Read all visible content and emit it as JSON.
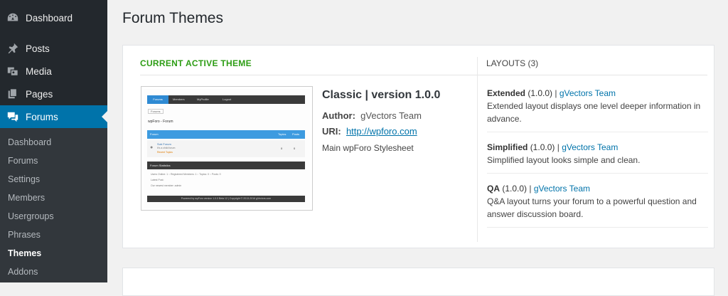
{
  "sidebar": {
    "top_items": [
      {
        "label": "Dashboard",
        "icon": "dashboard-icon"
      },
      {
        "label": "Posts",
        "icon": "pin-icon"
      },
      {
        "label": "Media",
        "icon": "media-icon"
      },
      {
        "label": "Pages",
        "icon": "pages-icon"
      },
      {
        "label": "Forums",
        "icon": "forums-icon"
      }
    ],
    "sub_items": [
      "Dashboard",
      "Forums",
      "Settings",
      "Members",
      "Usergroups",
      "Phrases",
      "Themes",
      "Addons"
    ]
  },
  "page_title": "Forum Themes",
  "current": {
    "section_title": "CURRENT ACTIVE THEME",
    "theme_name": "Classic | version 1.0.0",
    "author_label": "Author:",
    "author_value": "gVectors Team",
    "uri_label": "URI:",
    "uri_value": "http://wpforo.com",
    "description": "Main wpForo Stylesheet",
    "preview": {
      "nav": [
        "Forums",
        "Members",
        "MyProfile",
        "Logout"
      ],
      "crumb": "Forums",
      "title": "wpForo - Forum",
      "head_forum": "Forum",
      "head_topics": "Topics",
      "head_posts": "Posts",
      "sub_forum": "Sub Forum",
      "sub_forum_desc": "It's a child forum",
      "recent": "Recent Topics",
      "topics_count": "0",
      "posts_count": "0",
      "stats_head": "Forum Statistics",
      "stats_1": "Users Online: 1 :: Registered Members: 1 :: Topics: 0 :: Posts: 0",
      "stats_2": "Latest Post:",
      "stats_3": "Our newest member: admin",
      "footer": "Powered by wpForo version 1.0.0 Beta 12  |  Copyright © 2013-2016 gVectors.com"
    }
  },
  "layouts": {
    "title": "LAYOUTS (3)",
    "items": [
      {
        "name": "Extended",
        "version": "(1.0.0)",
        "sep": "|",
        "author": "gVectors Team",
        "description": "Extended layout displays one level deeper information in advance."
      },
      {
        "name": "Simplified",
        "version": "(1.0.0)",
        "sep": "|",
        "author": "gVectors Team",
        "description": "Simplified layout looks simple and clean."
      },
      {
        "name": "QA",
        "version": "(1.0.0)",
        "sep": "|",
        "author": "gVectors Team",
        "description": "Q&A layout turns your forum to a powerful question and answer discussion board."
      }
    ]
  },
  "colors": {
    "accent": "#0073aa",
    "active_green": "#2d9d14",
    "sidebar_bg": "#23282d"
  }
}
